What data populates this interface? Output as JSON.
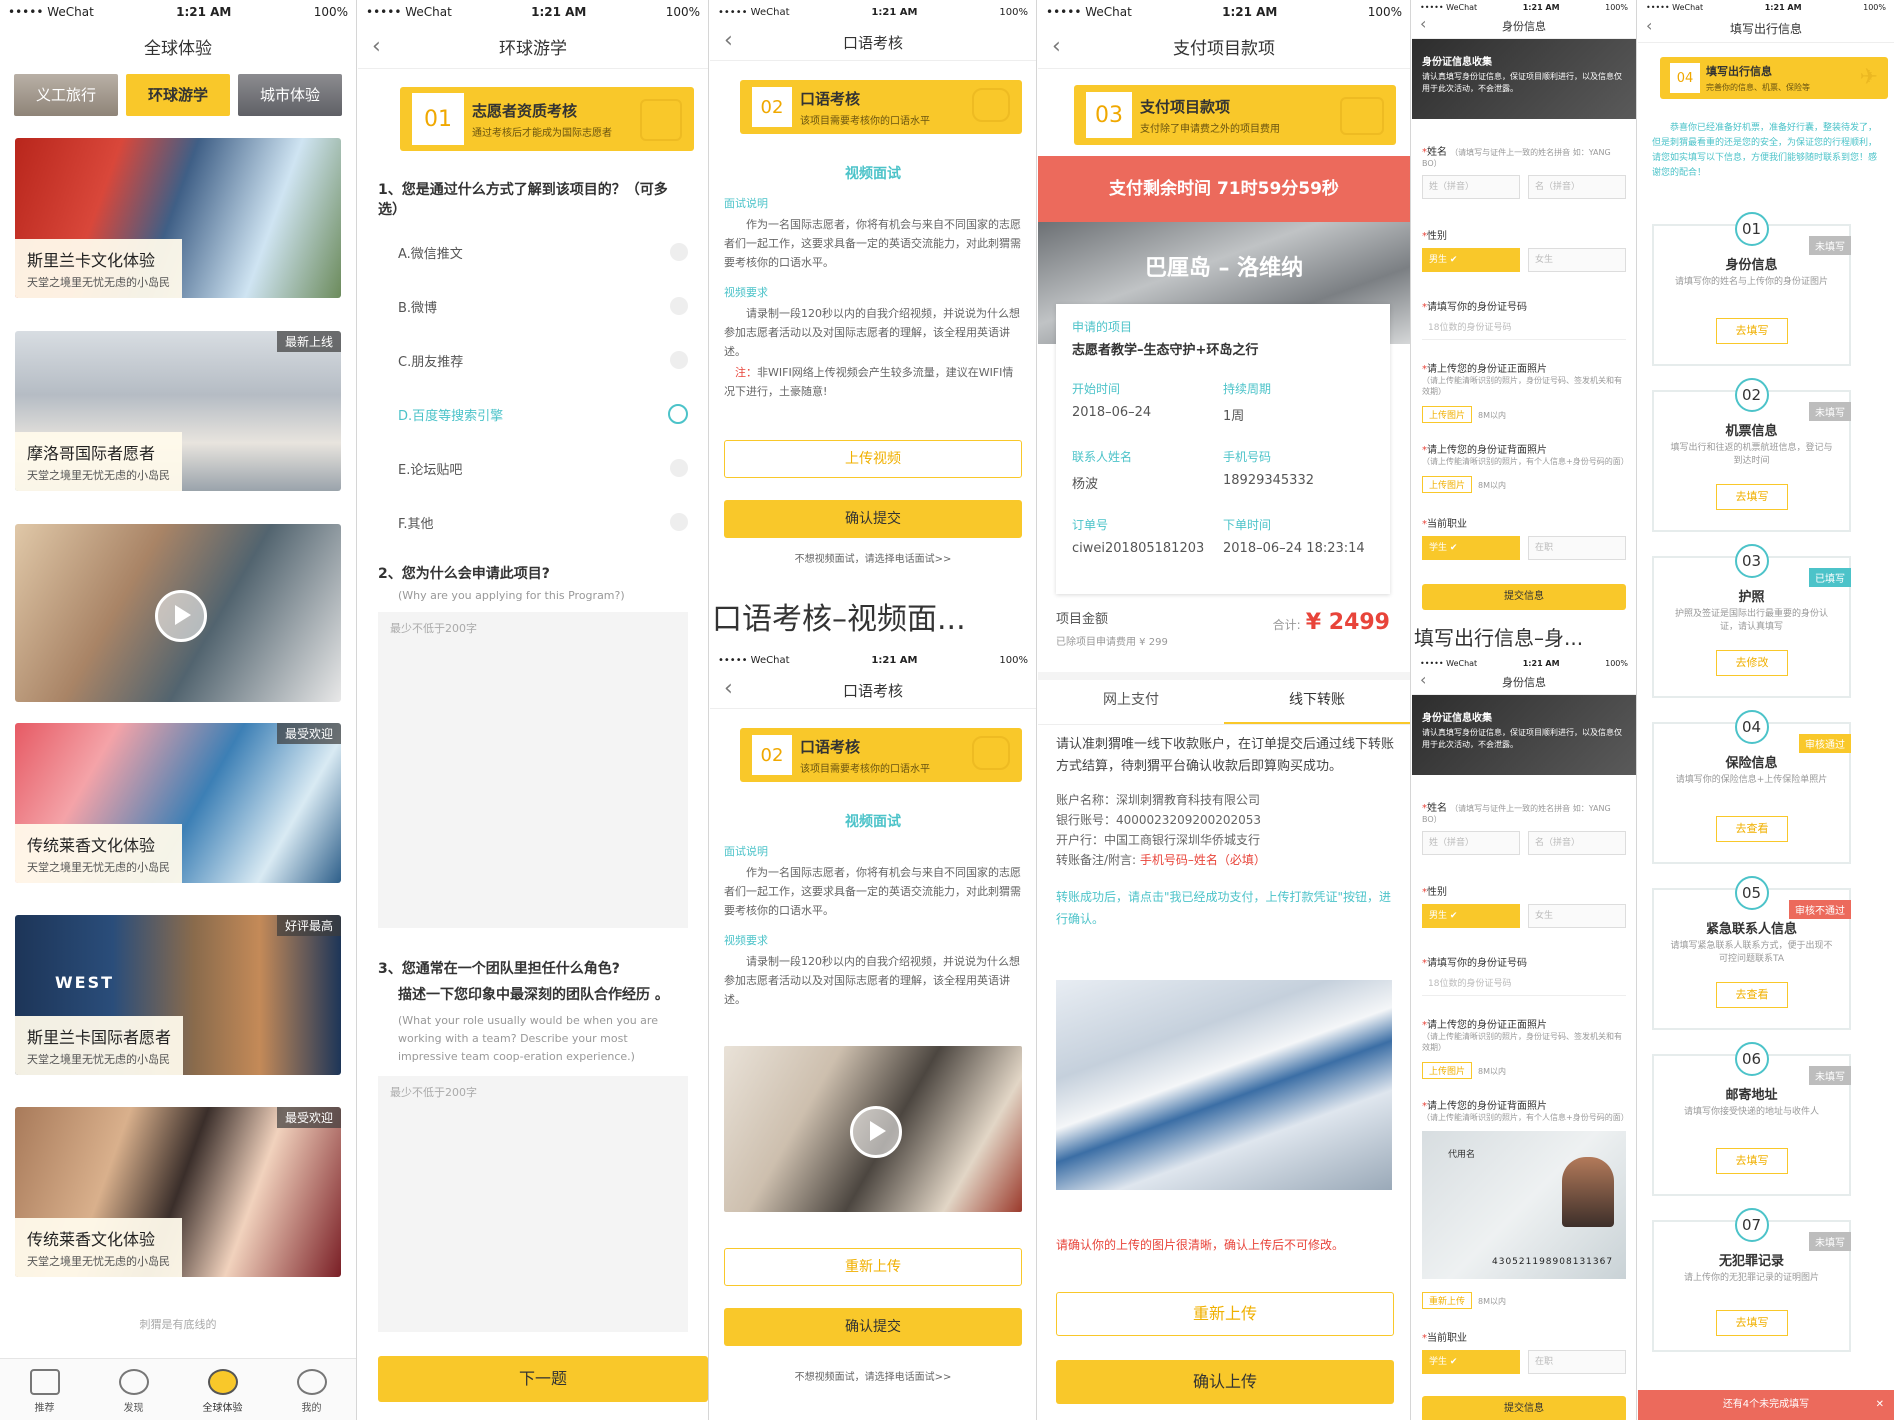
{
  "status": {
    "carrier": "••••• WeChat",
    "time": "1:21 AM",
    "battery": "100%"
  },
  "p1": {
    "title": "全球体验",
    "tabs": [
      "义工旅行",
      "环球游学",
      "城市体验"
    ],
    "cards": [
      {
        "title": "斯里兰卡文化体验",
        "sub": "天堂之境里无忧无虑的小岛民",
        "tag": ""
      },
      {
        "title": "摩洛哥国际者愿者",
        "sub": "天堂之境里无忧无虑的小岛民",
        "tag": "最新上线"
      },
      {
        "title": "",
        "sub": "",
        "tag": ""
      },
      {
        "title": "传统莱香文化体验",
        "sub": "天堂之境里无忧无虑的小岛民",
        "tag": "最受欢迎"
      },
      {
        "title": "斯里兰卡国际者愿者",
        "sub": "天堂之境里无忧无虑的小岛民",
        "tag": "好评最高"
      },
      {
        "title": "传统莱香文化体验",
        "sub": "天堂之境里无忧无虑的小岛民",
        "tag": "最受欢迎"
      }
    ],
    "footer_note": "刺猬是有底线的",
    "bottom_tabs": [
      "推荐",
      "发现",
      "全球体验",
      "我的"
    ]
  },
  "p2": {
    "title": "环球游学",
    "step_num": "01",
    "step_title": "志愿者资质考核",
    "step_sub": "通过考核后才能成为国际志愿者",
    "q1": "1、您是通过什么方式了解到该项目的？（可多选）",
    "options": [
      "A.微信推文",
      "B.微博",
      "C.朋友推荐",
      "D.百度等搜索引擎",
      "E.论坛贴吧",
      "F.其他"
    ],
    "q2": "2、您为什么会申请此项目?",
    "q2_en": "(Why are you applying for this Program?)",
    "placeholder": "最少不低于200字",
    "q3": "3、您通常在一个团队里担任什么角色?",
    "q3b": "描述一下您印象中最深刻的团队合作经历 。",
    "q3_en": "(What your role usually would be when you are working with a team? Describe your most impressive team coop-eration experience.)",
    "next": "下一题"
  },
  "p3": {
    "title": "口语考核",
    "step_num": "02",
    "step_title": "口语考核",
    "step_sub": "该项目需要考核你的口语水平",
    "section": "视频面试",
    "desc_h": "面试说明",
    "desc": "作为一名国际志愿者，你将有机会与来自不同国家的志愿者们一起工作，这要求具备一定的英语交流能力，对此刺猬需要考核你的口语水平。",
    "req_h": "视频要求",
    "req": "请录制一段120秒以内的自我介绍视频，并说说为什么想参加志愿者活动以及对国际志愿者的理解，该全程用英语讲述。",
    "note_label": "注：",
    "note": "非WIFI网络上传视频会产生较多流量，建议在WIFI情况下进行，土豪随意!",
    "upload": "上传视频",
    "reupload": "重新上传",
    "confirm": "确认提交",
    "alt": "不想视频面试，请选择电话面试>>",
    "screen_caption": "口语考核–视频面..."
  },
  "p4": {
    "title": "支付项目款项",
    "step_num": "03",
    "step_title": "支付项目款项",
    "step_sub": "支付除了申请费之外的项目费用",
    "timer": "支付剩余时间  71时59分59秒",
    "hero": "巴厘岛 – 洛维纳",
    "applied_label": "申请的项目",
    "applied": "志愿者教学–生态守护+环岛之行",
    "start_label": "开始时间",
    "start": "2018–06–24",
    "dur_label": "持续周期",
    "dur": "1周",
    "contact_label": "联系人姓名",
    "contact": "杨波",
    "phone_label": "手机号码",
    "phone": "18929345332",
    "order_label": "订单号",
    "order": "ciwei201805181203",
    "time_label": "下单时间",
    "time": "2018–06–24  18:23:14",
    "amount_label": "项目金额",
    "amount_sub": "已除项目申请费用 ¥ 299",
    "total_label": "合计:",
    "total": "¥ 2499",
    "tabs": [
      "网上支付",
      "线下转账"
    ],
    "intro": "请认准刺猬唯一线下收款账户，在订单提交后通过线下转账方式结算，待刺猬平台确认收款后即算购买成功。",
    "acct_name": "账户名称：深圳刺猬教育科技有限公司",
    "acct_no": "银行账号：4000023209200202053",
    "bank": "开户行：中国工商银行深圳华侨城支行",
    "memo_label": "转账备注/附言:",
    "memo": "手机号码–姓名（必填）",
    "tip": "转账成功后，请点击\"我已经成功支付，上传打款凭证\"按钮，进行确认。",
    "warn": "请确认你的上传的图片很清晰，确认上传后不可修改。",
    "reupload": "重新上传",
    "confirm": "确认上传"
  },
  "p5": {
    "title": "身份信息",
    "banner_title": "身份证信息收集",
    "banner_sub": "请认真填写身份证信息，保证项目顺利进行，以及信息仅用于此次活动，不会泄露。",
    "name_label": "姓名",
    "name_hint": "（请填写与证件上一致的姓名拼音  如：YANG BO）",
    "surname_ph": "姓（拼音）",
    "given_ph": "名（拼音）",
    "gender_label": "性别",
    "male": "男生",
    "female": "女生",
    "id_label": "请填写你的身份证号码",
    "id_ph": "18位数的身份证号码",
    "front_label": "请上传您的身份证正面照片",
    "front_hint": "（请上传能清晰识别的照片，身份证号码、签发机关和有效期）",
    "back_label": "请上传您的身份证背面照片",
    "back_hint": "（请上传能清晰识别的照片，有个人信息+身份号码的面）",
    "upload_chip": "上传图片",
    "limit": "8M以内",
    "reupload_chip": "重新上传",
    "job_label": "当前职业",
    "student": "学生",
    "employed": "在职",
    "submit": "提交信息",
    "caption": "填写出行信息–身...",
    "id_number": "430521198908131367",
    "id_name": "代用名"
  },
  "p6": {
    "title": "填写出行信息",
    "step_num": "04",
    "step_title": "填写出行信息",
    "step_sub": "完善你的信息、机票、保险等",
    "intro": "恭喜你已经准备好机票，准备好行囊，整装待发了，但是刺猬最看重的还是您的安全，为保证您的行程顺利，请您如实填写以下信息，方便我们能够随时联系到您！感谢您的配合！",
    "cards": [
      {
        "num": "01",
        "title": "身份信息",
        "desc": "请填写你的姓名与上传你的身份证图片",
        "btn": "去填写",
        "badge": "未填写",
        "badge_color": "#bdbdbd"
      },
      {
        "num": "02",
        "title": "机票信息",
        "desc": "填写出行和往返的机票航班信息，登记与到达时间",
        "btn": "去填写",
        "badge": "未填写",
        "badge_color": "#bdbdbd"
      },
      {
        "num": "03",
        "title": "护照",
        "desc": "护照及签证是国际出行最重要的身份认证，请认真填写",
        "btn": "去修改",
        "badge": "已填写",
        "badge_color": "#4cc3c9"
      },
      {
        "num": "04",
        "title": "保险信息",
        "desc": "请填写你的保险信息+上传保险单照片",
        "btn": "去查看",
        "badge": "审核通过",
        "badge_color": "#f9c82a"
      },
      {
        "num": "05",
        "title": "紧急联系人信息",
        "desc": "请填写紧急联系人联系方式，便于出现不可控问题联系TA",
        "btn": "去查看",
        "badge": "审核不通过",
        "badge_color": "#ec6a5c"
      },
      {
        "num": "06",
        "title": "邮寄地址",
        "desc": "请填写你接受快递的地址与收件人",
        "btn": "去填写",
        "badge": "未填写",
        "badge_color": "#bdbdbd"
      },
      {
        "num": "07",
        "title": "无犯罪记录",
        "desc": "请上传你的无犯罪记录的证明图片",
        "btn": "去填写",
        "badge": "未填写",
        "badge_color": "#bdbdbd"
      }
    ],
    "footer": "还有4个未完成填写"
  }
}
